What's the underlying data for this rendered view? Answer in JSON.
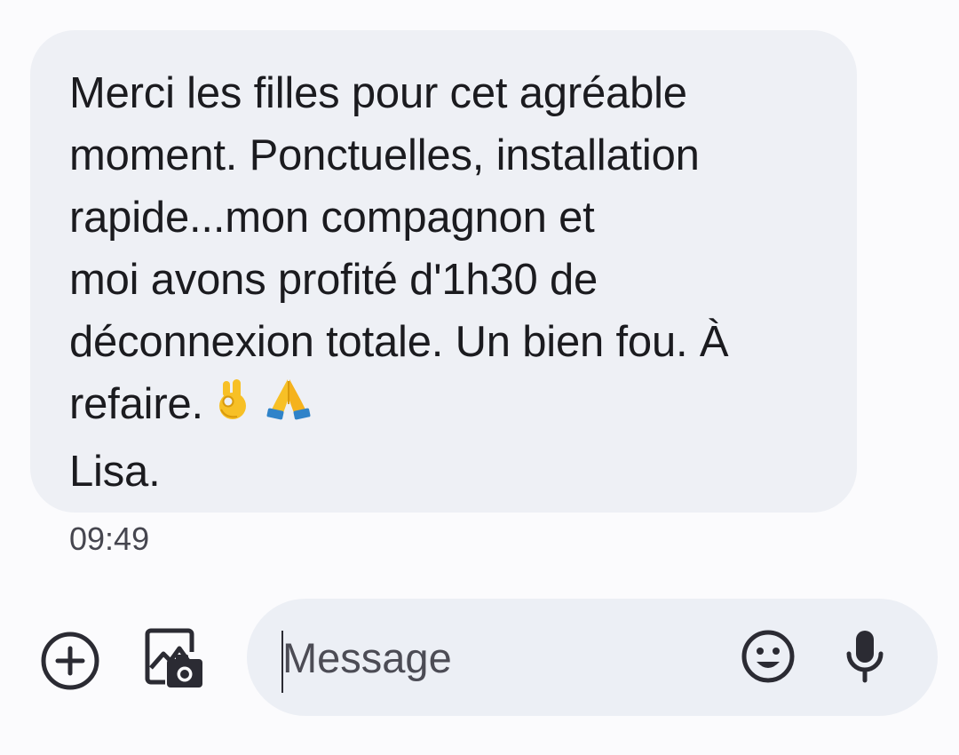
{
  "conversation": {
    "message": {
      "lines": [
        "Merci les filles pour cet agréable",
        "moment. Ponctuelles, installation",
        "rapide...mon compagnon et",
        "moi avons profité d'1h30 de",
        "déconnexion totale. Un bien fou. À",
        "refaire.",
        "Lisa."
      ],
      "emojis": [
        "ok-hand-emoji",
        "folded-hands-emoji"
      ],
      "timestamp": "09:49"
    }
  },
  "composer": {
    "placeholder": "Message",
    "icons": {
      "add": "add-circle-icon",
      "gallery": "gallery-camera-icon",
      "emoji": "emoji-smiley-icon",
      "voice": "microphone-icon"
    }
  },
  "colors": {
    "background": "#fbfbfd",
    "bubble": "#eef0f5",
    "input_pill": "#eceff5",
    "text": "#1b1b1f",
    "icon": "#2b2b33"
  }
}
